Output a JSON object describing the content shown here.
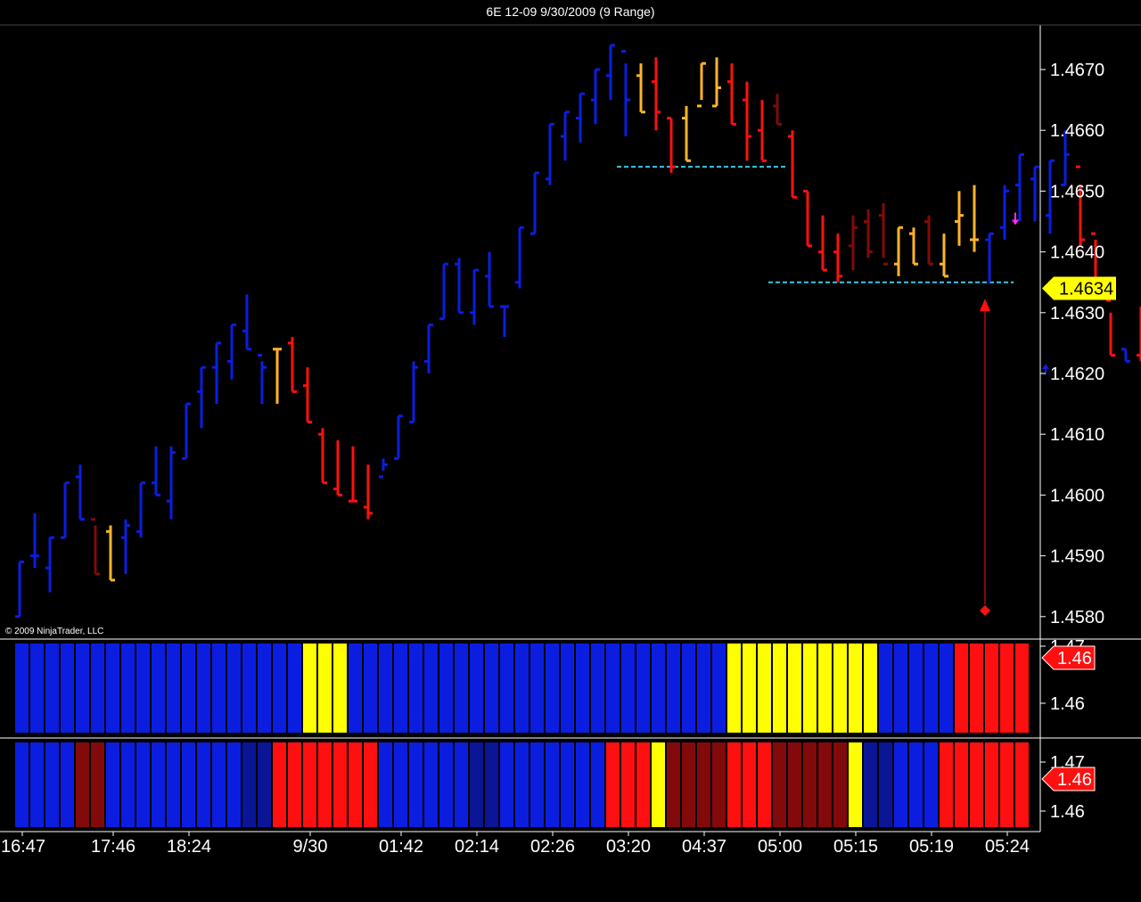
{
  "window": {
    "title": "6E 12-09  9/30/2009 (9 Range)"
  },
  "copyright": "© 2009 NinjaTrader, LLC",
  "colors": {
    "background": "#000000",
    "blue": "#0b1ee0",
    "dark_blue": "#0a1696",
    "red": "#ff1010",
    "dark_red": "#820a0a",
    "gold": "#ffb428",
    "yellow": "#ffff00",
    "cyan": "#38c8e8",
    "magenta": "#ff28ff",
    "axis_line": "#ffffff"
  },
  "chart_data": {
    "type": "bar",
    "subtype": "ohlc-range-bars",
    "title": "6E 12-09  9/30/2009 (9 Range)",
    "price_axis": {
      "ticks": [
        "1.4670",
        "1.4660",
        "1.4650",
        "1.4640",
        "1.4630",
        "1.4620",
        "1.4610",
        "1.4600",
        "1.4590",
        "1.4580"
      ],
      "ylim": [
        1.4577,
        1.468
      ],
      "last_price_label": "1.4634",
      "last_price": 1.4634
    },
    "time_axis": {
      "labels": [
        "16:47",
        "17:46",
        "18:24",
        "9/30",
        "01:42",
        "02:14",
        "02:26",
        "03:20",
        "04:37",
        "05:00",
        "05:15",
        "05:19",
        "05:24"
      ],
      "label_bar_index": [
        0,
        6,
        11,
        19,
        25,
        30,
        35,
        40,
        45,
        50,
        55,
        60,
        65
      ]
    },
    "bars": [
      {
        "o": 1.458,
        "h": 1.4589,
        "l": 1.458,
        "c": 1.4589,
        "color": "blue"
      },
      {
        "o": 1.459,
        "h": 1.4597,
        "l": 1.4588,
        "c": 1.459,
        "color": "blue"
      },
      {
        "o": 1.4588,
        "h": 1.4593,
        "l": 1.4584,
        "c": 1.4593,
        "color": "blue"
      },
      {
        "o": 1.4593,
        "h": 1.4602,
        "l": 1.4593,
        "c": 1.4602,
        "color": "blue"
      },
      {
        "o": 1.4603,
        "h": 1.4605,
        "l": 1.4596,
        "c": 1.4596,
        "color": "blue"
      },
      {
        "o": 1.4596,
        "h": 1.4595,
        "l": 1.4587,
        "c": 1.4587,
        "color": "dark_red"
      },
      {
        "o": 1.4594,
        "h": 1.4595,
        "l": 1.4586,
        "c": 1.4586,
        "color": "gold"
      },
      {
        "o": 1.4593,
        "h": 1.4596,
        "l": 1.4587,
        "c": 1.4595,
        "color": "blue"
      },
      {
        "o": 1.4594,
        "h": 1.4602,
        "l": 1.4593,
        "c": 1.4602,
        "color": "blue"
      },
      {
        "o": 1.4602,
        "h": 1.4608,
        "l": 1.46,
        "c": 1.46,
        "color": "blue"
      },
      {
        "o": 1.4599,
        "h": 1.4608,
        "l": 1.4596,
        "c": 1.4607,
        "color": "blue"
      },
      {
        "o": 1.4606,
        "h": 1.4615,
        "l": 1.4606,
        "c": 1.4615,
        "color": "blue"
      },
      {
        "o": 1.4617,
        "h": 1.4621,
        "l": 1.4611,
        "c": 1.4621,
        "color": "blue"
      },
      {
        "o": 1.4621,
        "h": 1.4625,
        "l": 1.4615,
        "c": 1.4625,
        "color": "blue"
      },
      {
        "o": 1.4622,
        "h": 1.4628,
        "l": 1.4619,
        "c": 1.4628,
        "color": "blue"
      },
      {
        "o": 1.4627,
        "h": 1.4633,
        "l": 1.4624,
        "c": 1.4624,
        "color": "blue"
      },
      {
        "o": 1.4623,
        "h": 1.4622,
        "l": 1.4615,
        "c": 1.4621,
        "color": "blue"
      },
      {
        "o": 1.4624,
        "h": 1.4624,
        "l": 1.4615,
        "c": 1.4624,
        "color": "gold"
      },
      {
        "o": 1.4625,
        "h": 1.4626,
        "l": 1.4617,
        "c": 1.4617,
        "color": "red"
      },
      {
        "o": 1.4618,
        "h": 1.4621,
        "l": 1.4612,
        "c": 1.4612,
        "color": "red"
      },
      {
        "o": 1.461,
        "h": 1.4611,
        "l": 1.4602,
        "c": 1.4602,
        "color": "red"
      },
      {
        "o": 1.4601,
        "h": 1.4609,
        "l": 1.46,
        "c": 1.46,
        "color": "red"
      },
      {
        "o": 1.4599,
        "h": 1.4608,
        "l": 1.4599,
        "c": 1.4599,
        "color": "red"
      },
      {
        "o": 1.4598,
        "h": 1.4605,
        "l": 1.4596,
        "c": 1.4597,
        "color": "red"
      },
      {
        "o": 1.4603,
        "h": 1.4606,
        "l": 1.4604,
        "c": 1.4605,
        "color": "blue"
      },
      {
        "o": 1.4606,
        "h": 1.4613,
        "l": 1.4606,
        "c": 1.4613,
        "color": "blue"
      },
      {
        "o": 1.4612,
        "h": 1.4622,
        "l": 1.4612,
        "c": 1.4621,
        "color": "blue"
      },
      {
        "o": 1.4622,
        "h": 1.4628,
        "l": 1.462,
        "c": 1.4628,
        "color": "blue"
      },
      {
        "o": 1.4629,
        "h": 1.4638,
        "l": 1.4629,
        "c": 1.4638,
        "color": "blue"
      },
      {
        "o": 1.4638,
        "h": 1.4639,
        "l": 1.463,
        "c": 1.463,
        "color": "blue"
      },
      {
        "o": 1.463,
        "h": 1.4637,
        "l": 1.4628,
        "c": 1.4637,
        "color": "blue"
      },
      {
        "o": 1.4636,
        "h": 1.464,
        "l": 1.4631,
        "c": 1.4631,
        "color": "blue"
      },
      {
        "o": 1.4631,
        "h": 1.4631,
        "l": 1.4626,
        "c": 1.4631,
        "color": "blue"
      },
      {
        "o": 1.4635,
        "h": 1.4644,
        "l": 1.4634,
        "c": 1.4644,
        "color": "blue"
      },
      {
        "o": 1.4643,
        "h": 1.4653,
        "l": 1.4643,
        "c": 1.4653,
        "color": "blue"
      },
      {
        "o": 1.4652,
        "h": 1.4661,
        "l": 1.4651,
        "c": 1.4661,
        "color": "blue"
      },
      {
        "o": 1.4659,
        "h": 1.4663,
        "l": 1.4655,
        "c": 1.4663,
        "color": "blue"
      },
      {
        "o": 1.4662,
        "h": 1.4666,
        "l": 1.4658,
        "c": 1.4666,
        "color": "blue"
      },
      {
        "o": 1.4665,
        "h": 1.467,
        "l": 1.4661,
        "c": 1.467,
        "color": "blue"
      },
      {
        "o": 1.4669,
        "h": 1.4674,
        "l": 1.4665,
        "c": 1.4674,
        "color": "blue"
      },
      {
        "o": 1.4673,
        "h": 1.4671,
        "l": 1.4659,
        "c": 1.4665,
        "color": "blue"
      },
      {
        "o": 1.4669,
        "h": 1.4671,
        "l": 1.4663,
        "c": 1.4663,
        "color": "gold"
      },
      {
        "o": 1.4668,
        "h": 1.4672,
        "l": 1.466,
        "c": 1.4663,
        "color": "red"
      },
      {
        "o": 1.4662,
        "h": 1.4662,
        "l": 1.4653,
        "c": 1.4654,
        "color": "red"
      },
      {
        "o": 1.4662,
        "h": 1.4664,
        "l": 1.4655,
        "c": 1.4655,
        "color": "gold"
      },
      {
        "o": 1.4664,
        "h": 1.4671,
        "l": 1.4665,
        "c": 1.4671,
        "color": "gold"
      },
      {
        "o": 1.4664,
        "h": 1.4672,
        "l": 1.4664,
        "c": 1.4667,
        "color": "gold"
      },
      {
        "o": 1.4668,
        "h": 1.4671,
        "l": 1.4661,
        "c": 1.4661,
        "color": "red"
      },
      {
        "o": 1.4665,
        "h": 1.4668,
        "l": 1.4655,
        "c": 1.4659,
        "color": "red"
      },
      {
        "o": 1.466,
        "h": 1.4665,
        "l": 1.4655,
        "c": 1.4655,
        "color": "red"
      },
      {
        "o": 1.4664,
        "h": 1.4666,
        "l": 1.4661,
        "c": 1.4661,
        "color": "dark_red"
      },
      {
        "o": 1.4659,
        "h": 1.466,
        "l": 1.4649,
        "c": 1.4649,
        "color": "red"
      },
      {
        "o": 1.465,
        "h": 1.465,
        "l": 1.4641,
        "c": 1.4641,
        "color": "red"
      },
      {
        "o": 1.464,
        "h": 1.4646,
        "l": 1.4637,
        "c": 1.4637,
        "color": "red"
      },
      {
        "o": 1.464,
        "h": 1.4643,
        "l": 1.4635,
        "c": 1.4636,
        "color": "red"
      },
      {
        "o": 1.4641,
        "h": 1.4646,
        "l": 1.4637,
        "c": 1.4644,
        "color": "dark_red"
      },
      {
        "o": 1.4645,
        "h": 1.4647,
        "l": 1.4639,
        "c": 1.464,
        "color": "dark_red"
      },
      {
        "o": 1.4646,
        "h": 1.4648,
        "l": 1.4639,
        "c": 1.4638,
        "color": "dark_red"
      },
      {
        "o": 1.4638,
        "h": 1.4644,
        "l": 1.4636,
        "c": 1.4644,
        "color": "gold"
      },
      {
        "o": 1.4643,
        "h": 1.4644,
        "l": 1.4638,
        "c": 1.4638,
        "color": "gold"
      },
      {
        "o": 1.4645,
        "h": 1.4646,
        "l": 1.4638,
        "c": 1.4638,
        "color": "dark_red"
      },
      {
        "o": 1.4638,
        "h": 1.4643,
        "l": 1.4636,
        "c": 1.4636,
        "color": "gold"
      },
      {
        "o": 1.4645,
        "h": 1.465,
        "l": 1.4641,
        "c": 1.4646,
        "color": "gold"
      },
      {
        "o": 1.4642,
        "h": 1.4651,
        "l": 1.464,
        "c": 1.4642,
        "color": "gold"
      },
      {
        "o": 1.4642,
        "h": 1.4643,
        "l": 1.4635,
        "c": 1.4643,
        "color": "blue"
      },
      {
        "o": 1.4644,
        "h": 1.4651,
        "l": 1.4642,
        "c": 1.465,
        "color": "blue"
      },
      {
        "o": 1.4651,
        "h": 1.4656,
        "l": 1.4645,
        "c": 1.4656,
        "color": "blue"
      },
      {
        "o": 1.4652,
        "h": 1.4654,
        "l": 1.4645,
        "c": 1.4654,
        "color": "blue"
      },
      {
        "o": 1.4646,
        "h": 1.4655,
        "l": 1.4643,
        "c": 1.4655,
        "color": "blue"
      },
      {
        "o": 1.4651,
        "h": 1.466,
        "l": 1.4651,
        "c": 1.4656,
        "color": "blue"
      },
      {
        "o": 1.4654,
        "h": 1.4651,
        "l": 1.4641,
        "c": 1.4642,
        "color": "red"
      },
      {
        "o": 1.4643,
        "h": 1.4642,
        "l": 1.4633,
        "c": 1.4633,
        "color": "red"
      },
      {
        "o": 1.4632,
        "h": 1.463,
        "l": 1.4623,
        "c": 1.4623,
        "color": "red"
      },
      {
        "o": 1.4624,
        "h": 1.4624,
        "l": 1.4622,
        "c": 1.4622,
        "color": "blue"
      },
      {
        "o": 1.4623,
        "h": 1.4631,
        "l": 1.4622,
        "c": 1.4631,
        "color": "red"
      },
      {
        "o": 1.4632,
        "h": 1.4635,
        "l": 1.4631,
        "c": 1.4634,
        "color": "red"
      }
    ],
    "levels": [
      {
        "price": 1.4654,
        "from_bar": 40,
        "to_bar": 50,
        "color": "cyan"
      },
      {
        "price": 1.4635,
        "from_bar": 50,
        "to_bar": 65,
        "color": "cyan"
      }
    ],
    "markers": [
      {
        "type": "arrow-up-line",
        "bar": 64,
        "from": 1.4582,
        "to": 1.4632,
        "color": "red"
      },
      {
        "type": "diamond",
        "bar": 64,
        "price": 1.4581,
        "color": "red"
      },
      {
        "type": "arrow-down",
        "bar": 66,
        "price": 1.4645,
        "color": "magenta"
      },
      {
        "type": "arrow-up",
        "bar": 68,
        "price": 1.4621,
        "color": "blue"
      }
    ],
    "indicator_1": {
      "ticks": [
        "1.47",
        "1.46"
      ],
      "value_label": "1.46",
      "colors": [
        "blue",
        "blue",
        "blue",
        "blue",
        "blue",
        "blue",
        "blue",
        "blue",
        "blue",
        "blue",
        "blue",
        "blue",
        "blue",
        "blue",
        "blue",
        "blue",
        "blue",
        "blue",
        "blue",
        "yellow",
        "yellow",
        "yellow",
        "blue",
        "blue",
        "blue",
        "blue",
        "blue",
        "blue",
        "blue",
        "blue",
        "blue",
        "blue",
        "blue",
        "blue",
        "blue",
        "blue",
        "blue",
        "blue",
        "blue",
        "blue",
        "blue",
        "blue",
        "blue",
        "blue",
        "blue",
        "blue",
        "blue",
        "yellow",
        "yellow",
        "yellow",
        "yellow",
        "yellow",
        "yellow",
        "yellow",
        "yellow",
        "yellow",
        "yellow",
        "blue",
        "blue",
        "blue",
        "blue",
        "blue",
        "red",
        "red",
        "red",
        "red",
        "red"
      ]
    },
    "indicator_2": {
      "ticks": [
        "1.47",
        "1.46"
      ],
      "value_label": "1.46",
      "colors": [
        "blue",
        "blue",
        "blue",
        "blue",
        "dark_red",
        "dark_red",
        "blue",
        "blue",
        "blue",
        "blue",
        "blue",
        "blue",
        "blue",
        "blue",
        "blue",
        "dark_blue",
        "dark_blue",
        "red",
        "red",
        "red",
        "red",
        "red",
        "red",
        "red",
        "blue",
        "blue",
        "blue",
        "blue",
        "blue",
        "blue",
        "dark_blue",
        "dark_blue",
        "blue",
        "blue",
        "blue",
        "blue",
        "blue",
        "blue",
        "blue",
        "red",
        "red",
        "red",
        "yellow",
        "dark_red",
        "dark_red",
        "dark_red",
        "dark_red",
        "red",
        "red",
        "red",
        "dark_red",
        "dark_red",
        "dark_red",
        "dark_red",
        "dark_red",
        "yellow",
        "dark_blue",
        "dark_blue",
        "blue",
        "blue",
        "blue",
        "red",
        "red",
        "red",
        "red",
        "red",
        "red"
      ]
    }
  }
}
